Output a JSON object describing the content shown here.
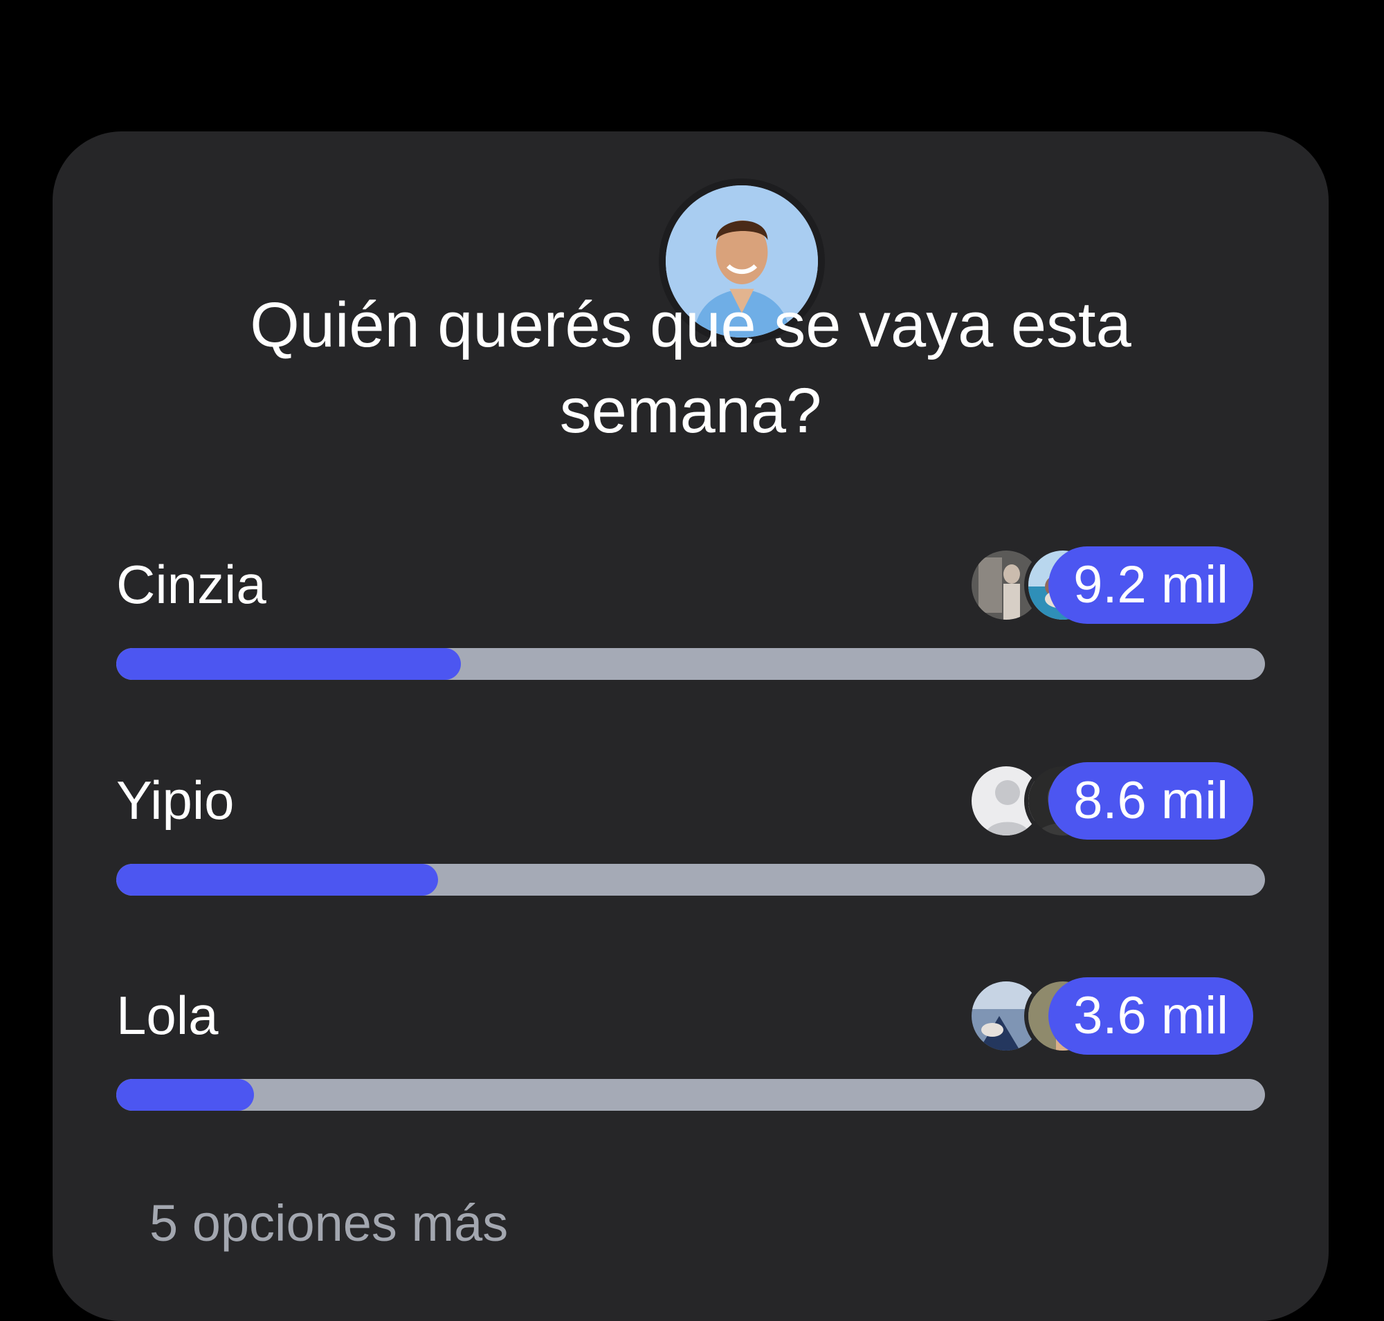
{
  "poll": {
    "question": "Quién querés que se vaya esta semana?",
    "options": [
      {
        "label": "Cinzia",
        "count": "9.2 mil",
        "fill_percent": 30,
        "voters": [
          "voter-photo",
          "voter-photo"
        ]
      },
      {
        "label": "Yipio",
        "count": "8.6 mil",
        "fill_percent": 28,
        "voters": [
          "default-avatar",
          "voter-photo"
        ]
      },
      {
        "label": "Lola",
        "count": "3.6 mil",
        "fill_percent": 12,
        "voters": [
          "voter-photo",
          "voter-photo"
        ]
      }
    ],
    "more_options": "5 opciones más"
  },
  "colors": {
    "background": "#000000",
    "card": "#262628",
    "accent": "#4c56f1",
    "track": "#a5aab6",
    "muted_text": "#a3a7b0"
  }
}
